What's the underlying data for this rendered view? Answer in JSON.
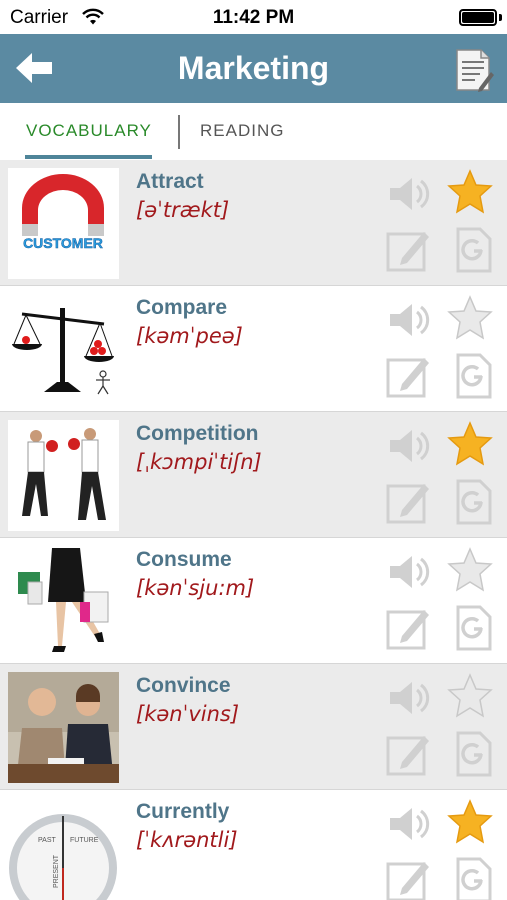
{
  "status_bar": {
    "carrier": "Carrier",
    "time": "11:42 PM"
  },
  "nav": {
    "title": "Marketing"
  },
  "tabs": [
    {
      "label": "VOCABULARY",
      "active": true
    },
    {
      "label": "READING",
      "active": false
    }
  ],
  "icons": {
    "back": "left-arrow-icon",
    "notes": "notes-icon",
    "speaker": "speaker-icon",
    "star": "star-icon",
    "edit": "edit-icon",
    "google": "google-icon"
  },
  "colors": {
    "nav_bar": "#5b8aa2",
    "active_tab": "#2a8a2a",
    "term": "#4f7589",
    "phonetic": "#a1191c",
    "star_favorite": "#f6b222",
    "shaded_row": "#ebebeb"
  },
  "logo_text": {
    "customer_magnet": "CUSTOMER",
    "clock_labels": [
      "PAST",
      "FUTURE",
      "PRESENT"
    ]
  },
  "words": [
    {
      "term": "Attract",
      "phonetic": "[əˈtrækt]",
      "favorite": true,
      "image": "magnet-attracting-customer",
      "shaded": true
    },
    {
      "term": "Compare",
      "phonetic": "[kəmˈpeə]",
      "favorite": false,
      "image": "balance-scale",
      "shaded": false
    },
    {
      "term": "Competition",
      "phonetic": "[ˌkɔmpiˈtiʃn]",
      "favorite": true,
      "image": "businessmen-boxing",
      "shaded": true
    },
    {
      "term": "Consume",
      "phonetic": "[kənˈsju:m]",
      "favorite": false,
      "image": "woman-with-shopping-bags",
      "shaded": false
    },
    {
      "term": "Convince",
      "phonetic": "[kənˈvins]",
      "favorite": false,
      "image": "people-at-desk",
      "shaded": true
    },
    {
      "term": "Currently",
      "phonetic": "[ˈkʌrəntli]",
      "favorite": true,
      "image": "clock-past-present-future",
      "shaded": false
    }
  ]
}
